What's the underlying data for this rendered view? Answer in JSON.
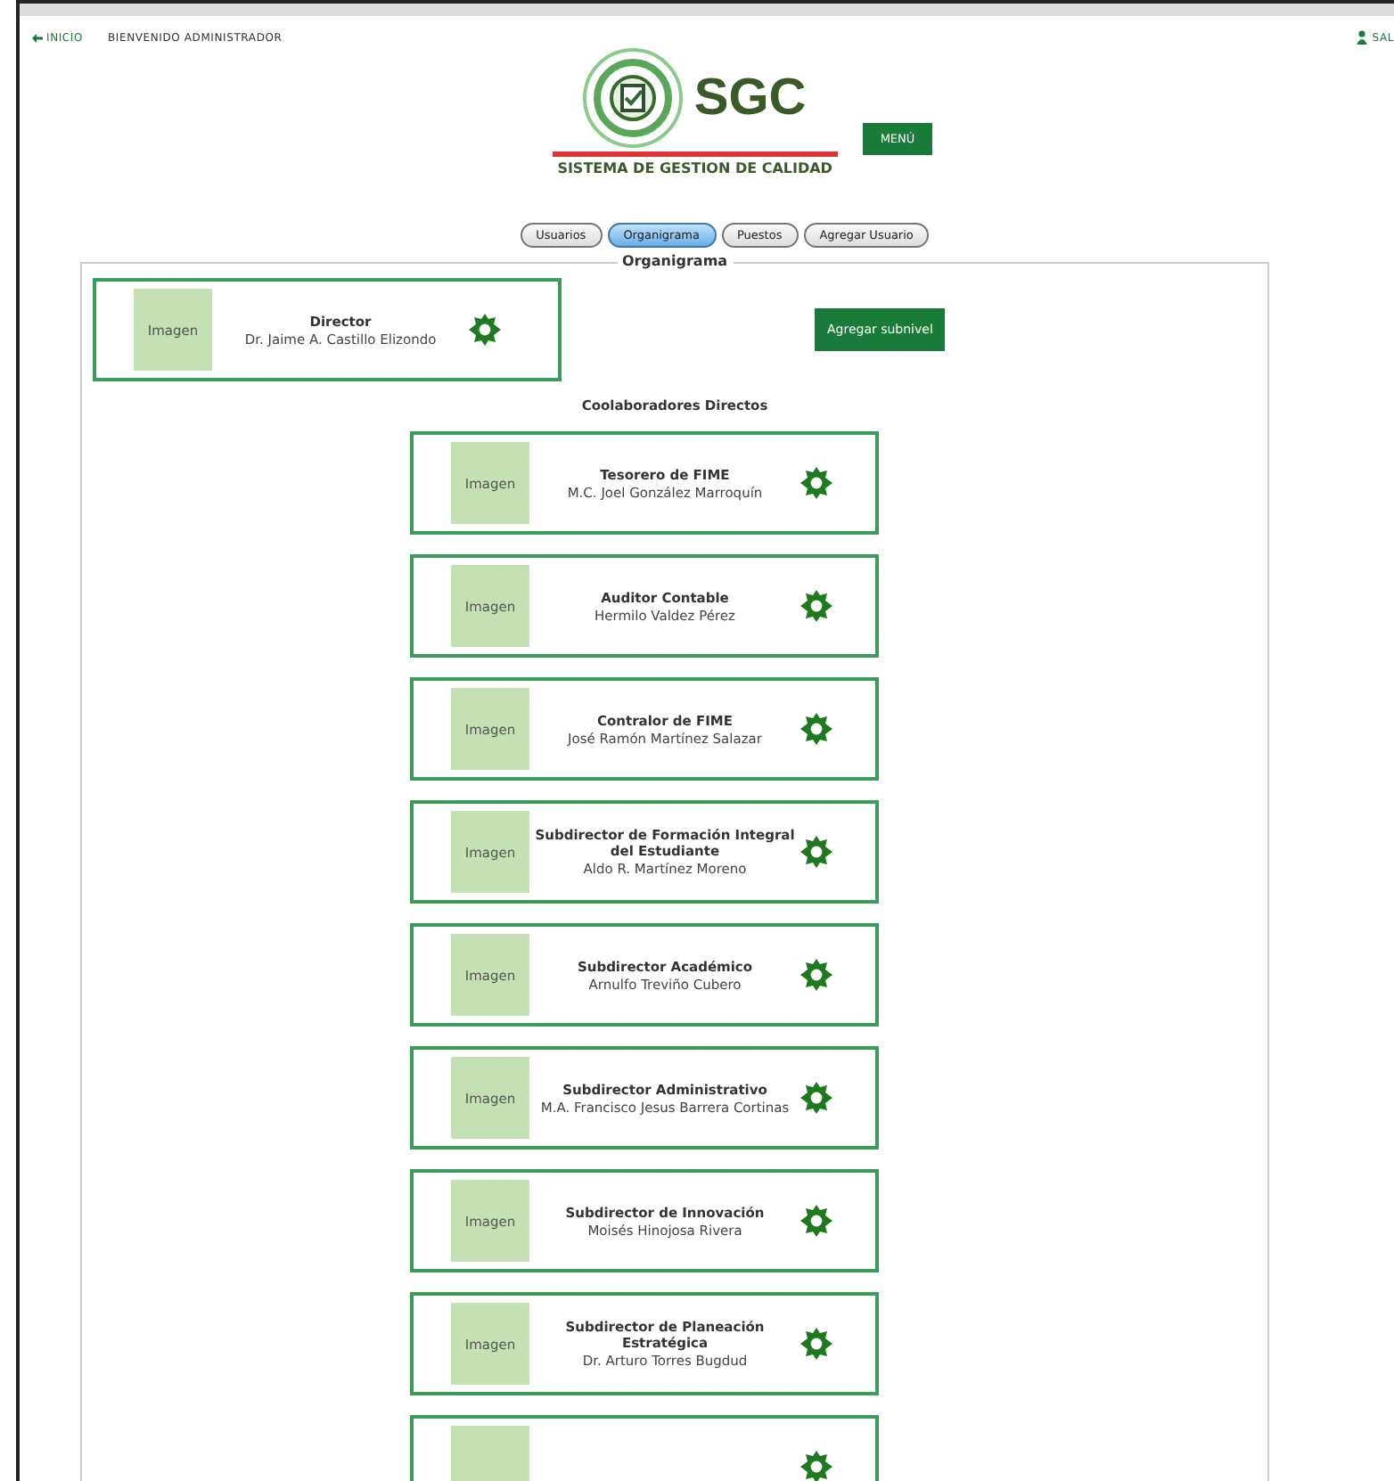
{
  "top_bar": {
    "home_link": "INICIO",
    "welcome": "BIENVENIDO ADMINISTRADOR",
    "exit_link": "SAL"
  },
  "header": {
    "logo_text": "SGC",
    "logo_subtitle": "SISTEMA DE GESTION DE CALIDAD",
    "menu_button": "MENÚ"
  },
  "tabs": [
    {
      "label": "Usuarios",
      "selected": false
    },
    {
      "label": "Organigrama",
      "selected": true
    },
    {
      "label": "Puestos",
      "selected": false
    },
    {
      "label": "Agregar Usuario",
      "selected": false
    }
  ],
  "panel": {
    "legend": "Organigrama",
    "add_button": "Agregar subnivel",
    "collaborators_heading": "Coolaboradores Directos"
  },
  "director": {
    "image_label": "Imagen",
    "title": "Director",
    "name": "Dr. Jaime A. Castillo Elizondo"
  },
  "collaborators": [
    {
      "kind": "card",
      "image_label": "Imagen",
      "title": "Tesorero de FIME",
      "name": "M.C. Joel González Marroquín"
    },
    {
      "kind": "card",
      "image_label": "Imagen",
      "title": "Auditor Contable",
      "name": "Hermilo Valdez Pérez"
    },
    {
      "kind": "card",
      "image_label": "Imagen",
      "title": "Contralor de FIME",
      "name": "José Ramón Martínez Salazar"
    },
    {
      "kind": "card",
      "image_label": "Imagen",
      "title": "Subdirector de Formación Integral del Estudiante",
      "name": "Aldo R. Martínez Moreno"
    },
    {
      "kind": "card",
      "image_label": "Imagen",
      "title": "Subdirector Académico",
      "name": "Arnulfo Treviño Cubero"
    },
    {
      "kind": "card",
      "image_label": "Imagen",
      "title": "Subdirector Administrativo",
      "name": "M.A. Francisco Jesus Barrera Cortinas"
    },
    {
      "kind": "card",
      "image_label": "Imagen",
      "title": "Subdirector de Innovación",
      "name": "Moisés Hinojosa Rivera"
    },
    {
      "kind": "card",
      "image_label": "Imagen",
      "title": "Subdirector de Planeación Estratégica",
      "name": "Dr. Arturo Torres Bugdud"
    },
    {
      "kind": "partial"
    }
  ]
}
